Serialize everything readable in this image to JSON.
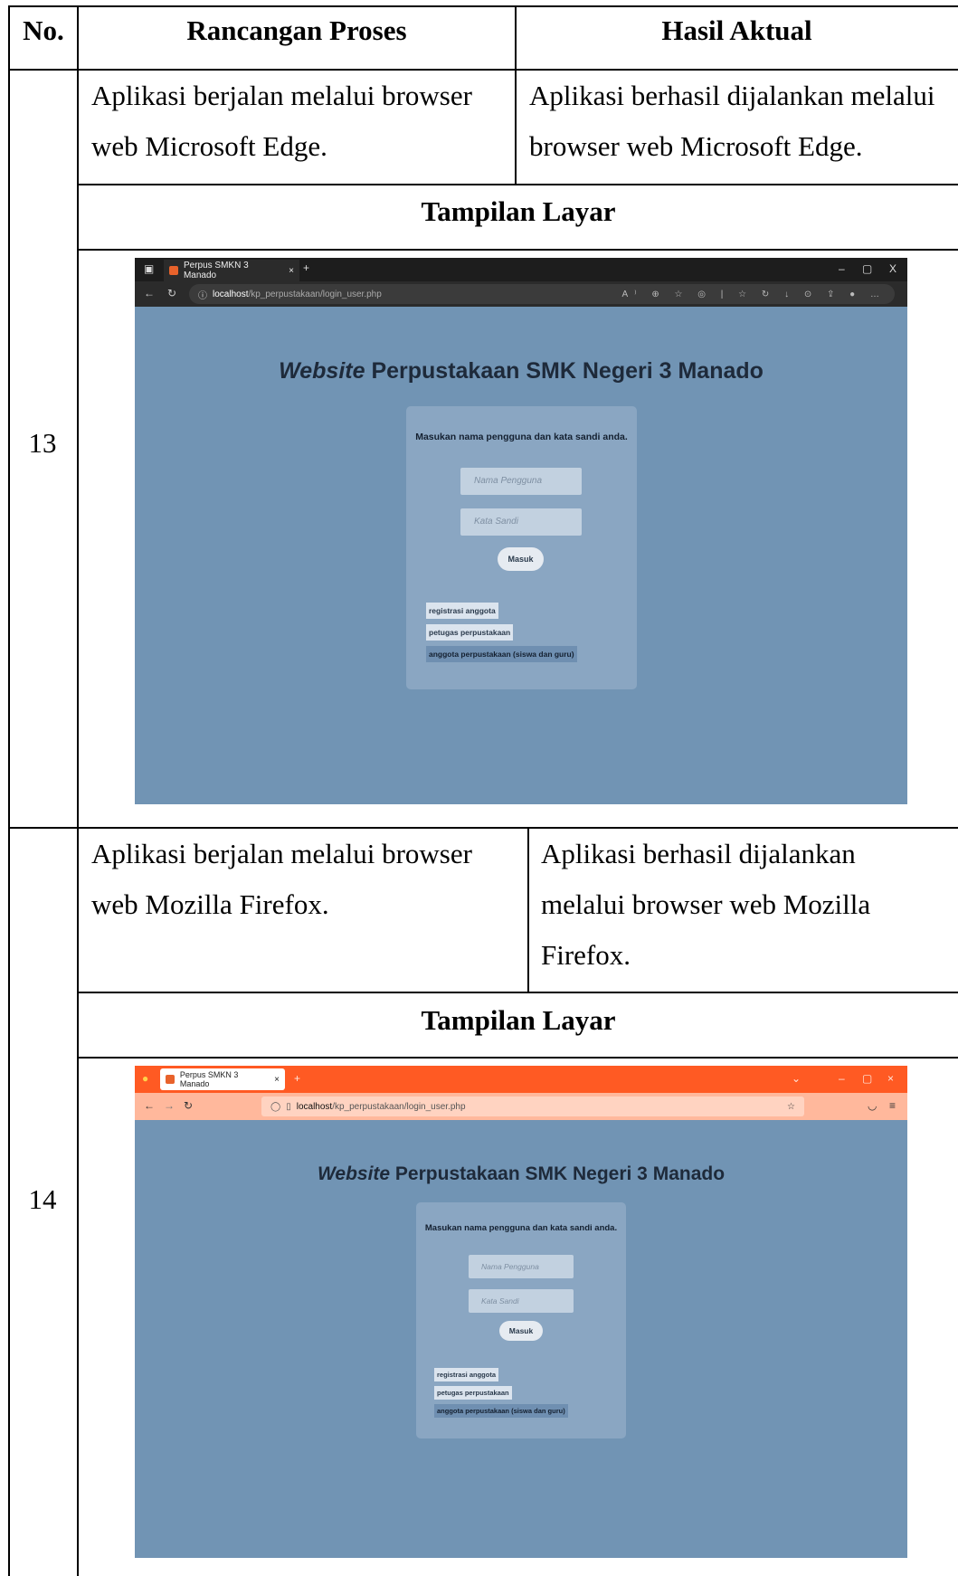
{
  "table": {
    "headers": {
      "no": "No.",
      "rancangan": "Rancangan Proses",
      "hasil": "Hasil Aktual"
    },
    "rows": [
      {
        "no": "13",
        "rancangan": [
          "Aplikasi berjalan melalui browser",
          "web Microsoft Edge."
        ],
        "hasil": [
          "Aplikasi berhasil dijalankan melalui",
          "browser web Microsoft Edge."
        ],
        "tampilan": "Tampilan Layar"
      },
      {
        "no": "14",
        "rancangan": [
          "Aplikasi berjalan melalui browser",
          "web Mozilla Firefox."
        ],
        "hasil": [
          "Aplikasi berhasil dijalankan",
          "melalui browser web Mozilla",
          "Firefox."
        ],
        "tampilan": "Tampilan Layar"
      }
    ]
  },
  "screens": {
    "edge": {
      "browser": "Microsoft Edge",
      "tab_title": "Perpus SMKN 3 Manado",
      "url_host": "localhost",
      "url_path": "/kp_perpustakaan/login_user.php",
      "window_controls": [
        "–",
        "▢",
        "X"
      ]
    },
    "firefox": {
      "browser": "Mozilla Firefox",
      "tab_title": "Perpus SMKN 3 Manado",
      "url_host": "localhost",
      "url_path": "/kp_perpustakaan/login_user.php",
      "window_controls": [
        "–",
        "▢",
        "×"
      ]
    },
    "page": {
      "title_italic": "Website",
      "title_rest": " Perpustakaan SMK Negeri 3 Manado",
      "prompt": "Masukan nama pengguna dan kata sandi anda.",
      "username_placeholder": "Nama Pengguna",
      "password_placeholder": "Kata Sandi",
      "submit": "Masuk",
      "links": [
        "registrasi anggota",
        "petugas perpustakaan",
        "anggota perpustakaan (siswa dan guru)"
      ]
    },
    "colors": {
      "page_bg": "#7194b4",
      "card_bg": "#8aa6c2",
      "firefox_accent": "#ff5a23",
      "edge_chrome": "#1d1d1d"
    }
  }
}
